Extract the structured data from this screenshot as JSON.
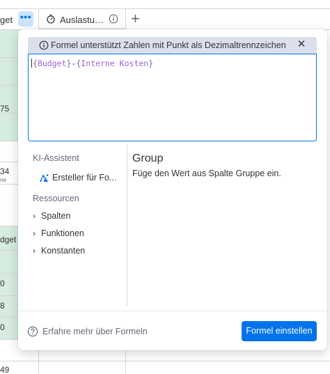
{
  "board": {
    "header": {
      "budget_column_label": "get",
      "more_button": "•••",
      "auslastung_column_label": "Auslastu…",
      "add_column": "+"
    },
    "left_column_cells": [
      "75",
      "34",
      "ne",
      "dget",
      "0",
      "8",
      "0",
      "49"
    ]
  },
  "formula_popup": {
    "notice": {
      "text": "Formel unterstützt Zahlen mit Punkt als Dezimaltrennzeichen",
      "close": "✕"
    },
    "editor": {
      "tokens": [
        {
          "type": "brace",
          "text": "{"
        },
        {
          "type": "ref",
          "text": "Budget"
        },
        {
          "type": "brace",
          "text": "}"
        },
        {
          "type": "op",
          "text": "-"
        },
        {
          "type": "brace",
          "text": "{"
        },
        {
          "type": "ref",
          "text": "Interne Kosten"
        },
        {
          "type": "brace",
          "text": "}"
        }
      ]
    },
    "sidebar": {
      "ai_heading": "KI-Assistent",
      "ai_item": "Ersteller für Fo...",
      "resources_heading": "Ressourcen",
      "items": [
        {
          "label": "Spalten"
        },
        {
          "label": "Funktionen"
        },
        {
          "label": "Konstanten"
        }
      ]
    },
    "detail": {
      "title": "Group",
      "description": "Füge den Wert aus Spalte Gruppe ein."
    },
    "footer": {
      "help_text": "Erfahre mehr über Formeln",
      "submit_button": "Formel einstellen"
    }
  },
  "colors": {
    "accent": "#0073ea",
    "notice_bg": "#dcdfec",
    "reference_token": "#a25ddc",
    "group_green": "#d7ece0"
  }
}
